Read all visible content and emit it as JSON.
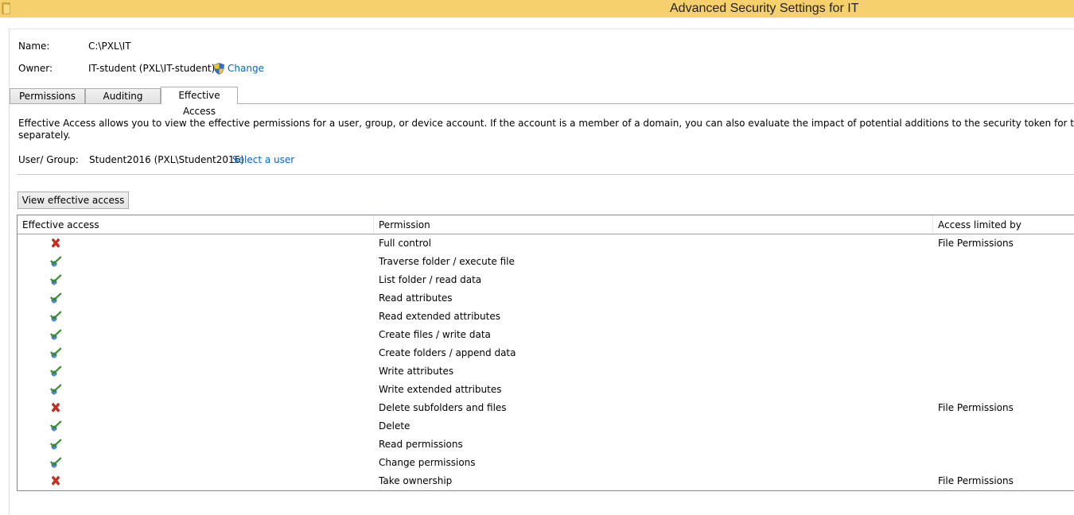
{
  "window": {
    "title": "Advanced Security Settings for IT"
  },
  "header": {
    "name_label": "Name:",
    "name_value": "C:\\PXL\\IT",
    "owner_label": "Owner:",
    "owner_value": "IT-student (PXL\\IT-student)",
    "change_link": "Change"
  },
  "tabs": [
    {
      "label": "Permissions"
    },
    {
      "label": "Auditing"
    },
    {
      "label": "Effective Access",
      "active": true
    }
  ],
  "description": {
    "line1": "Effective Access allows you to view the effective permissions for a user, group, or device account. If the account is a member of a domain, you can also evaluate the impact of potential additions to the security token for the account. When you evaluate t",
    "line2": "separately."
  },
  "user_group": {
    "label": "User/ Group:",
    "value": "Student2016 (PXL\\Student2016)",
    "select_link": "Select a user"
  },
  "view_button": "View effective access",
  "table": {
    "columns": [
      "Effective access",
      "Permission",
      "Access limited by"
    ],
    "rows": [
      {
        "allowed": false,
        "icon": "deny-x-icon",
        "permission": "Full control",
        "limited_by": "File Permissions"
      },
      {
        "allowed": true,
        "icon": "allow-check-icon",
        "permission": "Traverse folder / execute file",
        "limited_by": ""
      },
      {
        "allowed": true,
        "icon": "allow-check-icon",
        "permission": "List folder / read data",
        "limited_by": ""
      },
      {
        "allowed": true,
        "icon": "allow-check-icon",
        "permission": "Read attributes",
        "limited_by": ""
      },
      {
        "allowed": true,
        "icon": "allow-check-icon",
        "permission": "Read extended attributes",
        "limited_by": ""
      },
      {
        "allowed": true,
        "icon": "allow-check-icon",
        "permission": "Create files / write data",
        "limited_by": ""
      },
      {
        "allowed": true,
        "icon": "allow-check-icon",
        "permission": "Create folders / append data",
        "limited_by": ""
      },
      {
        "allowed": true,
        "icon": "allow-check-icon",
        "permission": "Write attributes",
        "limited_by": ""
      },
      {
        "allowed": true,
        "icon": "allow-check-icon",
        "permission": "Write extended attributes",
        "limited_by": ""
      },
      {
        "allowed": false,
        "icon": "deny-x-icon",
        "permission": "Delete subfolders and files",
        "limited_by": "File Permissions"
      },
      {
        "allowed": true,
        "icon": "allow-check-icon",
        "permission": "Delete",
        "limited_by": ""
      },
      {
        "allowed": true,
        "icon": "allow-check-icon",
        "permission": "Read permissions",
        "limited_by": ""
      },
      {
        "allowed": true,
        "icon": "allow-check-icon",
        "permission": "Change permissions",
        "limited_by": ""
      },
      {
        "allowed": false,
        "icon": "deny-x-icon",
        "permission": "Take ownership",
        "limited_by": "File Permissions"
      }
    ]
  },
  "colors": {
    "titlebar": "#f5d06c",
    "link": "#0066cc",
    "deny": "#d42a1e",
    "allow": "#3a9a2e"
  }
}
